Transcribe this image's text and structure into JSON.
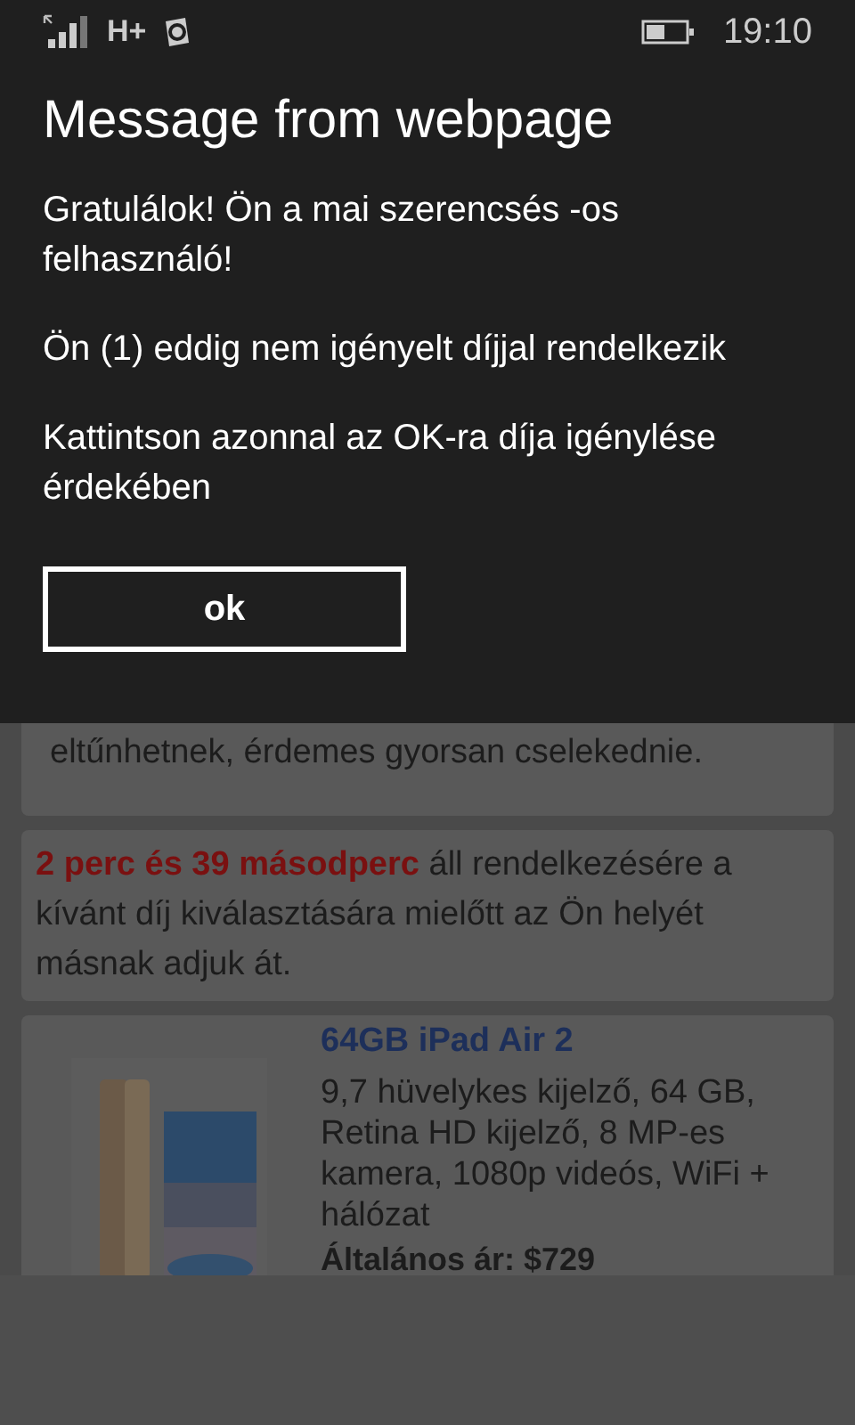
{
  "status_bar": {
    "network": "H+",
    "time": "19:10"
  },
  "dialog": {
    "title": "Message from webpage",
    "paragraphs": [
      "Gratulálok! Ön a mai szerencsés -os felhasználó!",
      "Ön (1) eddig nem igényelt díjjal rendelkezik",
      "Kattintson azonnal az OK-ra díja igénylése érdekében"
    ],
    "button": "ok"
  },
  "page": {
    "notice": "eltűnhetnek, érdemes gyorsan cselekednie.",
    "timer": "**2 perc és 39 másodperc** áll rendelkezésére a kívánt díj kiválasztására mielőtt az Ön helyét másnak adjuk át.",
    "product": {
      "title": "64GB iPad Air 2",
      "description": "9,7 hüvelykes kijelző, 64 GB, Retina HD kijelző, 8 MP-es kamera, 1080p videós, WiFi + hálózat",
      "price": "Általános ár: $729"
    }
  }
}
